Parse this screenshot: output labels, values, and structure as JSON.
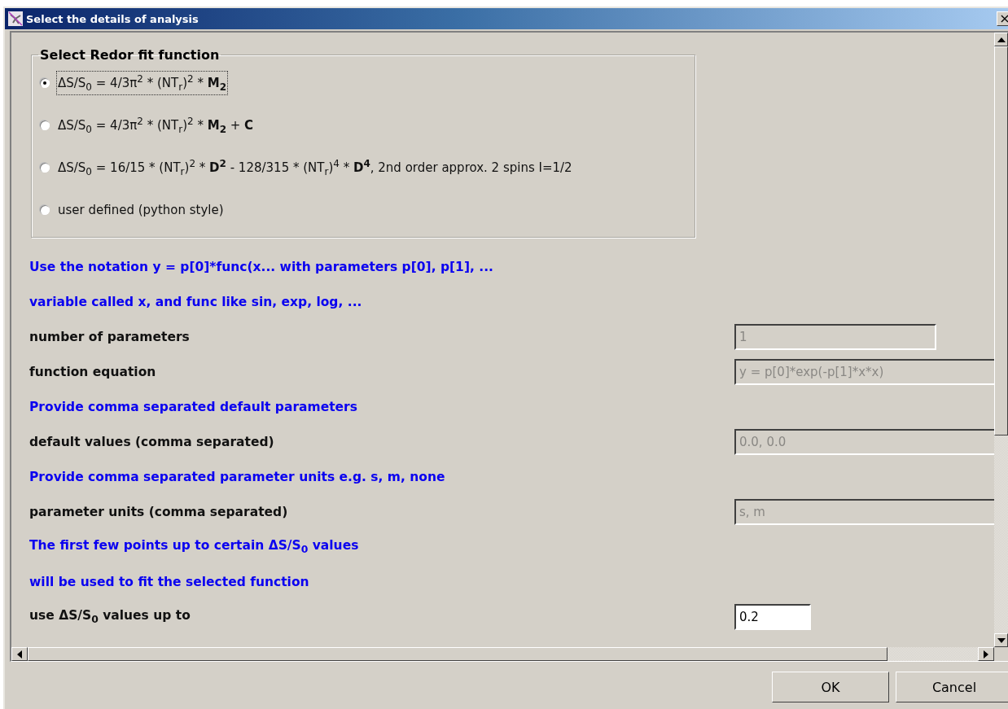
{
  "window": {
    "title": "Select the details of analysis",
    "close": "×"
  },
  "group": {
    "title": "Select Redor fit function",
    "options": [
      {
        "label": "ΔS/S$_{0}$ = 4/3π$^{2}$ * (NT$_{r}$)$^{2}$ * **M**$_{2}$",
        "selected": true
      },
      {
        "label": "ΔS/S$_{0}$ = 4/3π$^{2}$ * (NT$_{r}$)$^{2}$ * **M**$_{2}$ + **C**",
        "selected": false
      },
      {
        "label": "ΔS/S$_{0}$ = 16/15 * (NT$_{r}$)$^{2}$ * **D**$^{2}$ - 128/315 * (NT$_{r}$)$^{4}$ * **D**$^{4}$, 2nd order approx. 2 spins I=1/2",
        "selected": false
      },
      {
        "label": "user defined (python style)",
        "selected": false
      }
    ]
  },
  "rows": [
    {
      "kind": "note",
      "text": "Use the notation y = p[0]*func(x... with parameters p[0], p[1], ..."
    },
    {
      "kind": "note",
      "text": "variable called x, and func like sin, exp, log, ..."
    },
    {
      "kind": "field",
      "label": "number of parameters",
      "value": "1",
      "disabled": true
    },
    {
      "kind": "field",
      "label": "function equation",
      "value": "y = p[0]*exp(-p[1]*x*x)",
      "disabled": true
    },
    {
      "kind": "note",
      "text": "Provide comma separated default parameters"
    },
    {
      "kind": "field",
      "label": "default values (comma separated)",
      "value": "0.0, 0.0",
      "disabled": true
    },
    {
      "kind": "note",
      "text": "Provide comma separated parameter units e.g. s, m, none"
    },
    {
      "kind": "field",
      "label": "parameter units (comma separated)",
      "value": "s, m",
      "disabled": true
    },
    {
      "kind": "note",
      "text": "The first few points up to certain ΔS/S$_{0}$ values"
    },
    {
      "kind": "note",
      "text": "will be used to fit the selected function"
    },
    {
      "kind": "field",
      "label": "use ΔS/S$_{0}$ values up to",
      "value": "0.2",
      "disabled": false
    }
  ],
  "buttons": [
    "OK",
    "Cancel"
  ]
}
